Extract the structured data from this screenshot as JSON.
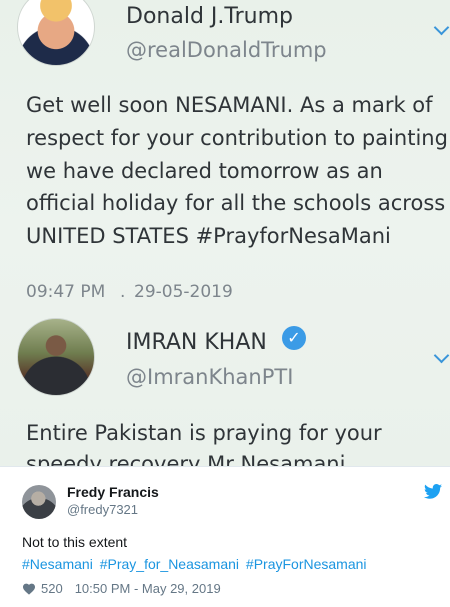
{
  "screenshot": {
    "trump_tweet": {
      "name": "Donald J.Trump",
      "handle": "@realDonaldTrump",
      "lines": [
        "Get well soon NESAMANI. As a mark of",
        "respect for your contribution to painting",
        "we have declared tomorrow as an",
        "official holiday for all the schools across",
        "UNITED STATES #PrayforNesaMani"
      ],
      "time": "09:47 PM",
      "date": "29-05-2019"
    },
    "imran_tweet": {
      "name": "IMRAN KHAN",
      "handle": "@ImranKhanPTI",
      "lines": [
        "Entire Pakistan is praying for your",
        "speedy recovery Mr Nesamani"
      ]
    }
  },
  "tweet": {
    "display_name": "Fredy Francis",
    "handle": "@fredy7321",
    "text": "Not to this extent",
    "hashtags": [
      "#Nesamani",
      "#Pray_for_Neasamani",
      "#PrayForNesamani"
    ],
    "likes": "520",
    "timestamp": "10:50 PM - May 29, 2019"
  },
  "icons": {
    "twitter": "twitter-bird-icon",
    "like": "heart-icon",
    "verified": "verified-badge-icon",
    "chevron": "chevron-down-icon"
  },
  "colors": {
    "twitter_blue": "#1b95e0",
    "muted": "#657786"
  }
}
